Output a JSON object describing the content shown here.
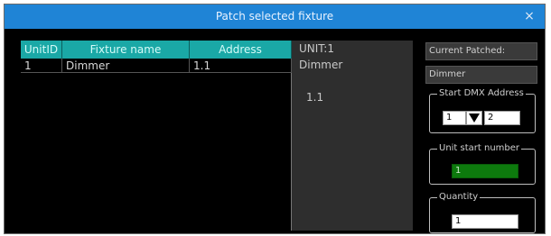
{
  "window": {
    "title": "Patch selected fixture",
    "close_glyph": "×"
  },
  "table": {
    "columns": [
      "UnitID",
      "Fixture name",
      "Address"
    ],
    "rows": [
      {
        "unit_id": "1",
        "fixture_name": "Dimmer",
        "address": "1.1"
      }
    ],
    "header_color": "#1aa8a6"
  },
  "info": {
    "unit_label": "UNIT:1",
    "fixture": "Dimmer",
    "address": "1.1"
  },
  "current_patched": {
    "label": "Current Patched:",
    "value": "Dimmer"
  },
  "start_dmx": {
    "legend": "Start DMX Address",
    "universe": "1",
    "address": "2"
  },
  "unit_start": {
    "legend": "Unit start number",
    "value": "1",
    "color": "#0d7a0d"
  },
  "quantity": {
    "legend": "Quantity",
    "value": "1"
  },
  "colors": {
    "title_bar": "#1f84d6",
    "panel": "#2e2e2e"
  }
}
